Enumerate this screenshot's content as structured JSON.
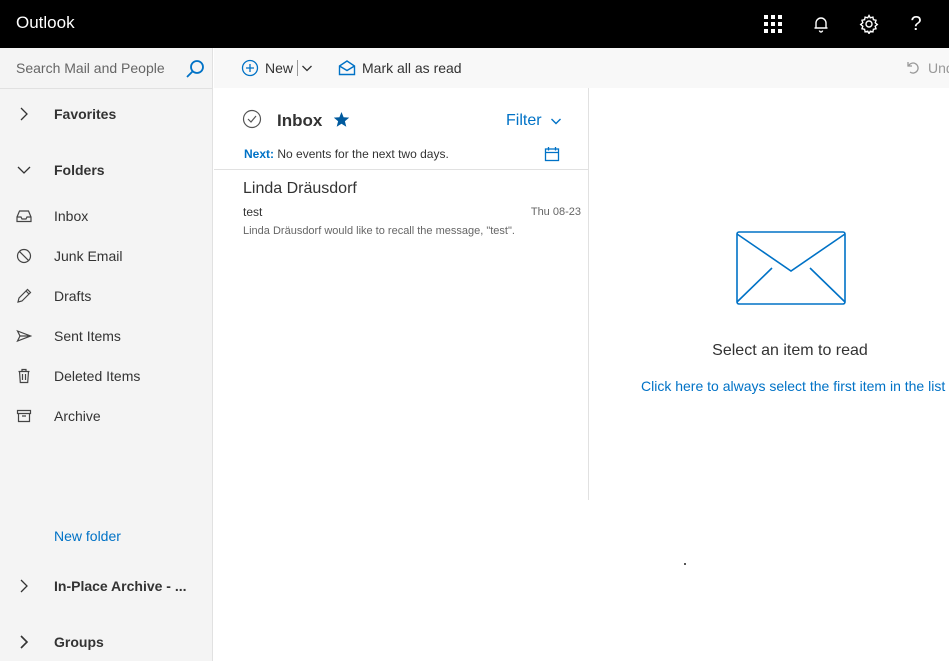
{
  "app": {
    "title": "Outlook"
  },
  "topbar": {
    "icons": [
      "app-launcher-icon",
      "bell-icon",
      "gear-icon",
      "help-icon"
    ],
    "help_glyph": "?"
  },
  "search": {
    "placeholder": "Search Mail and People"
  },
  "sidebar": {
    "favorites": "Favorites",
    "folders": "Folders",
    "items": [
      {
        "label": "Inbox",
        "icon": "inbox-icon"
      },
      {
        "label": "Junk Email",
        "icon": "junk-icon"
      },
      {
        "label": "Drafts",
        "icon": "pencil-icon"
      },
      {
        "label": "Sent Items",
        "icon": "send-icon"
      },
      {
        "label": "Deleted Items",
        "icon": "trash-icon"
      },
      {
        "label": "Archive",
        "icon": "archive-icon"
      }
    ],
    "new_folder": "New folder",
    "in_place_archive": "In-Place Archive - ...",
    "groups": "Groups"
  },
  "commands": {
    "new_label": "New",
    "mark_all_read": "Mark all as read",
    "undo_label": "Und"
  },
  "list": {
    "title": "Inbox",
    "filter": "Filter",
    "next_label": "Next:",
    "next_text": "No events for the next two days.",
    "messages": [
      {
        "sender": "Linda Dräusdorf",
        "subject": "test",
        "date": "Thu 08-23",
        "preview": "Linda Dräusdorf would like to recall the message, \"test\"."
      }
    ]
  },
  "reading": {
    "message": "Select an item to read",
    "link": "Click here to always select the first item in the list"
  },
  "colors": {
    "accent": "#0072c6",
    "topbar": "#000000",
    "sidebar": "#f4f4f4"
  }
}
